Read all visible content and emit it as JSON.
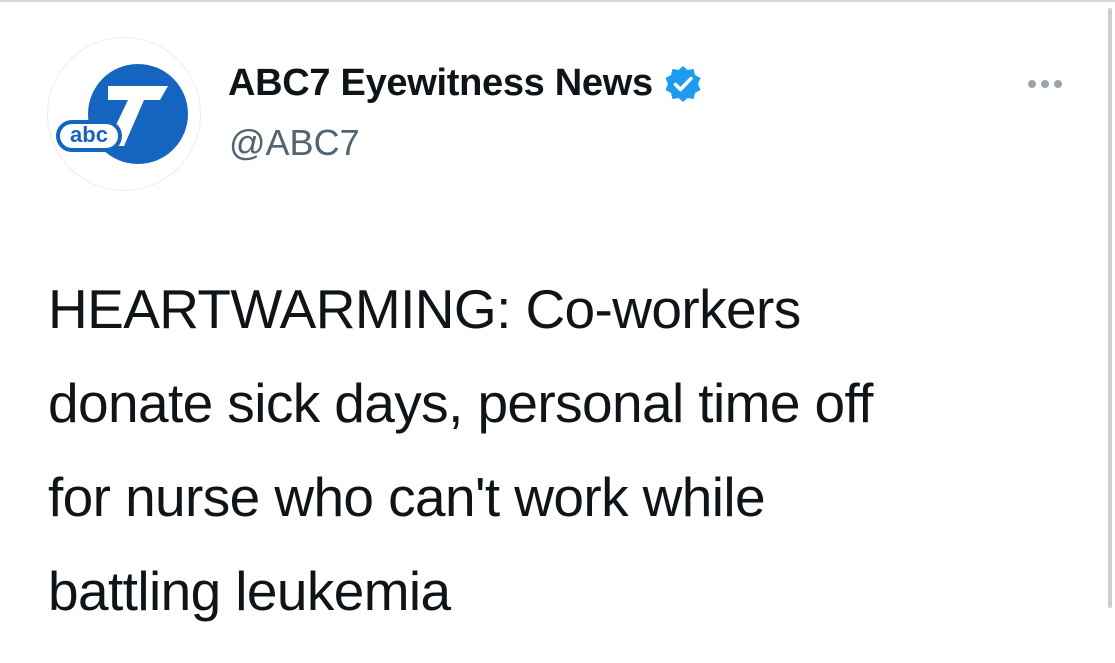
{
  "tweet": {
    "author": {
      "display_name": "ABC7 Eyewitness News",
      "handle": "@ABC7",
      "verified": true,
      "avatar_logo_text": "abc7"
    },
    "more_icon": "more-horizontal-icon",
    "text": "HEARTWARMING: Co-workers\ndonate sick days, personal time off\nfor nurse who can't work while\nbattling leukemia"
  },
  "colors": {
    "verified_badge": "#1d9bf0",
    "logo_blue": "#1565c0",
    "text_primary": "#0f1419",
    "text_secondary": "#536471"
  }
}
